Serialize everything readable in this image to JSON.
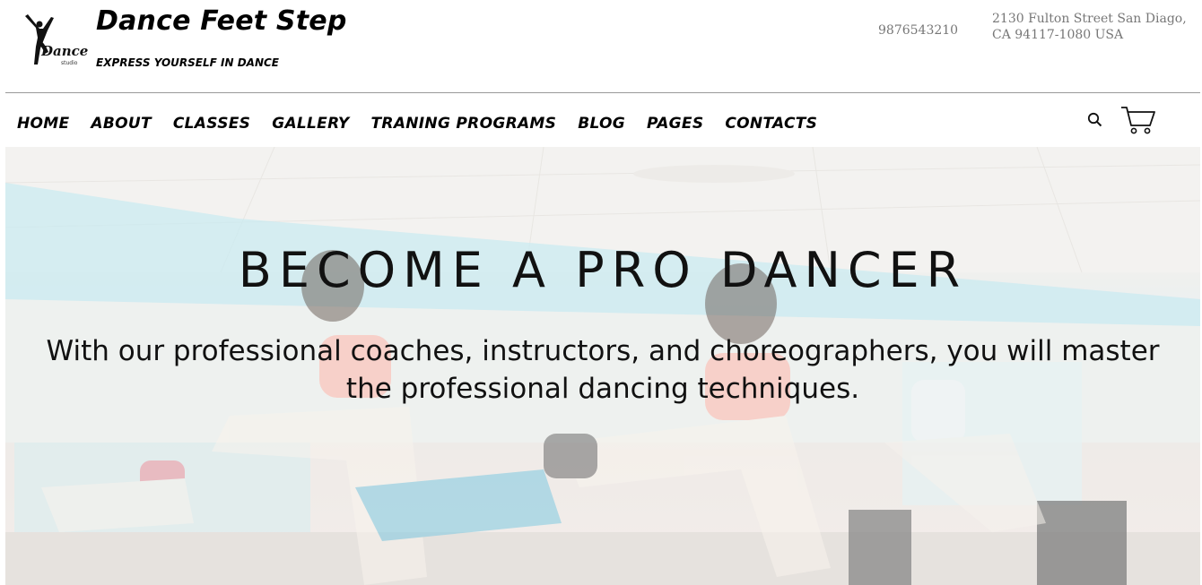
{
  "brand": {
    "title": "Dance Feet Step",
    "tagline": "EXPRESS YOURSELF IN DANCE",
    "logo_text": "Dance",
    "logo_subtext": "studio"
  },
  "contact": {
    "phone": "9876543210",
    "address_line1": "2130 Fulton Street San Diago,",
    "address_line2": "CA 94117-1080 USA"
  },
  "nav": {
    "items": [
      {
        "label": "HOME"
      },
      {
        "label": "ABOUT"
      },
      {
        "label": "CLASSES"
      },
      {
        "label": "GALLERY"
      },
      {
        "label": "TRANING PROGRAMS"
      },
      {
        "label": "BLOG"
      },
      {
        "label": "PAGES"
      },
      {
        "label": "CONTACTS"
      }
    ],
    "icons": [
      "search-icon",
      "cart-icon"
    ]
  },
  "hero": {
    "title": "BECOME A PRO DANCER",
    "text": "With our professional coaches, instructors, and choreographers, you will master the professional dancing techniques."
  },
  "colors": {
    "text": "#000000",
    "muted": "#777777",
    "divider": "#999999"
  }
}
